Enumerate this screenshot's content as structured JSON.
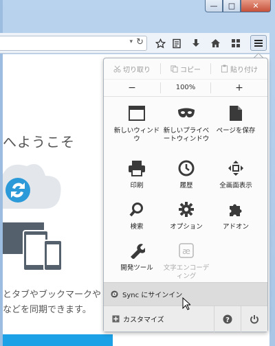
{
  "window": {
    "minimize_glyph": "—",
    "maximize_glyph": "□",
    "close_glyph": "✕"
  },
  "toolbar": {
    "url_dropdown_glyph": "▾",
    "reload_glyph": "↻",
    "icons": [
      "star-icon",
      "reading-list-icon",
      "download-icon",
      "home-icon",
      "pocket-icon",
      "hamburger-menu-icon"
    ]
  },
  "page": {
    "welcome": "へようこそ",
    "sync_text_line1": "とタブやブックマークや",
    "sync_text_line2": "などを同期できます。"
  },
  "panel": {
    "edit": {
      "cut": "切り取り",
      "copy": "コピー",
      "paste": "貼り付け"
    },
    "zoom": {
      "minus": "−",
      "value": "100%",
      "plus": "+"
    },
    "tiles": [
      {
        "label": "新しいウィンドウ"
      },
      {
        "label": "新しいプライベートウィンドウ"
      },
      {
        "label": "ページを保存"
      },
      {
        "label": "印刷"
      },
      {
        "label": "履歴"
      },
      {
        "label": "全画面表示"
      },
      {
        "label": "検索"
      },
      {
        "label": "オプション"
      },
      {
        "label": "アドオン"
      },
      {
        "label": "開発ツール"
      },
      {
        "label": "文字エンコーディング"
      }
    ],
    "sync_label": "Sync にサインイン",
    "customize_label": "カスタマイズ"
  },
  "colors": {
    "accent_blue": "#1da1e6",
    "menu_gray": "#dcdcdc"
  }
}
